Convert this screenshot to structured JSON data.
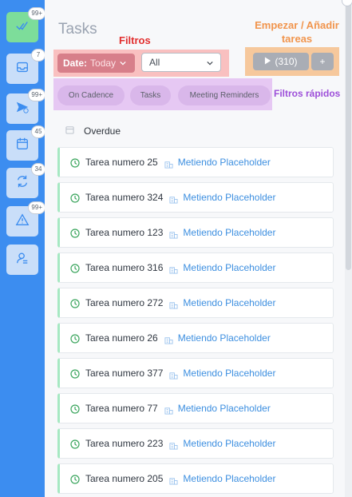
{
  "sidebar": {
    "items": [
      {
        "icon": "double-check-icon",
        "badge": "99+",
        "active": true
      },
      {
        "icon": "inbox-icon",
        "badge": "7",
        "active": false
      },
      {
        "icon": "send-icon",
        "badge": "99+",
        "active": false
      },
      {
        "icon": "calendar-icon",
        "badge": "45",
        "active": false
      },
      {
        "icon": "refresh-icon",
        "badge": "34",
        "active": false
      },
      {
        "icon": "warning-icon",
        "badge": "99+",
        "active": false
      },
      {
        "icon": "user-settings-icon",
        "badge": "",
        "active": false
      }
    ]
  },
  "header": {
    "title": "Tasks"
  },
  "annotations": {
    "filters": "Filtros",
    "start_line1": "Empezar / Añadir",
    "start_line2": "tareas",
    "quick_filters": "Filtros rápidos"
  },
  "filters": {
    "date_label": "Date:",
    "date_value": "Today",
    "select_value": "All"
  },
  "actions": {
    "start_count": "(310)",
    "add_label": "+"
  },
  "quick_filters": [
    "On Cadence",
    "Tasks",
    "Meeting Reminders"
  ],
  "section": {
    "label": "Overdue"
  },
  "tasks": [
    {
      "name": "Tarea numero 25",
      "company": "Metiendo Placeholder"
    },
    {
      "name": "Tarea numero 324",
      "company": "Metiendo Placeholder"
    },
    {
      "name": "Tarea numero 123",
      "company": "Metiendo Placeholder"
    },
    {
      "name": "Tarea numero 316",
      "company": "Metiendo Placeholder"
    },
    {
      "name": "Tarea numero 272",
      "company": "Metiendo Placeholder"
    },
    {
      "name": "Tarea numero 26",
      "company": "Metiendo Placeholder"
    },
    {
      "name": "Tarea numero 377",
      "company": "Metiendo Placeholder"
    },
    {
      "name": "Tarea numero 77",
      "company": "Metiendo Placeholder"
    },
    {
      "name": "Tarea numero 223",
      "company": "Metiendo Placeholder"
    },
    {
      "name": "Tarea numero 205",
      "company": "Metiendo Placeholder"
    }
  ],
  "colors": {
    "sidebar": "#3c8df0",
    "active_item": "#7ddd9a",
    "filters_highlight": "#f9c0c0",
    "start_highlight": "#f6c89c",
    "quick_highlight": "#e6c8f3",
    "company_link": "#3d8fe0",
    "task_accent": "#a6e8c2"
  }
}
